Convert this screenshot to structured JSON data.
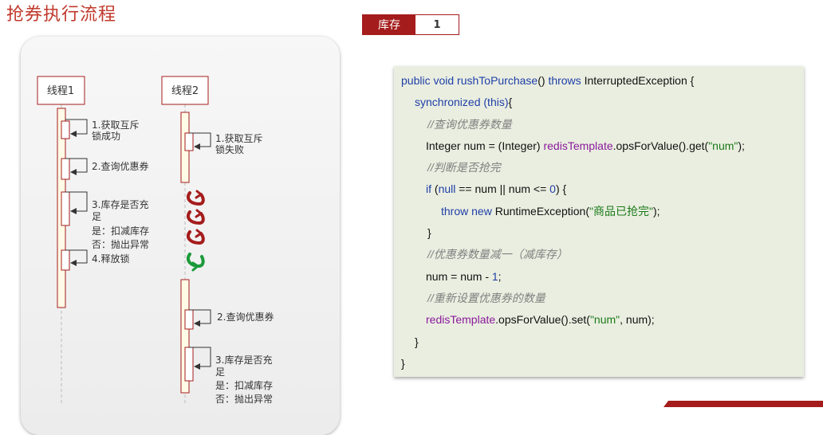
{
  "title": "抢券执行流程",
  "stock": {
    "label": "库存",
    "value": "1"
  },
  "diagram": {
    "thread1": "线程1",
    "thread2": "线程2",
    "t1_steps": {
      "s1a": "1.获取互斥",
      "s1b": "锁成功",
      "s2": "2.查询优惠券",
      "s3a": "3.库存是否充",
      "s3b": "足",
      "s3c": "是：扣减库存",
      "s3d": "否：抛出异常",
      "s4": "4.释放锁"
    },
    "t2_steps": {
      "s1a": "1.获取互斥",
      "s1b": "锁失败",
      "s2": "2.查询优惠券",
      "s3a": "3.库存是否充",
      "s3b": "足",
      "s3c": "是：扣减库存",
      "s3d": "否：抛出异常"
    }
  },
  "code": {
    "l1": {
      "a": "public void ",
      "b": "rushToPurchase",
      "c": "() ",
      "d": "throws ",
      "e": "InterruptedException {"
    },
    "l2": {
      "a": "synchronized ",
      "b": "(this)",
      "c": "{"
    },
    "l3": "//查询优惠券数量",
    "l4": {
      "a": "Integer num = (Integer) ",
      "b": "redisTemplate",
      "c": ".opsForValue().get(",
      "d": "\"num\"",
      "e": ");"
    },
    "l5": "//判断是否抢完",
    "l6": {
      "a": "if ",
      "b": "(",
      "c": "null",
      "d": " == num || num <= ",
      "e": "0",
      "f": ") {"
    },
    "l7": {
      "a": "throw new ",
      "b": "RuntimeException(",
      "c": "\"商品已抢完\"",
      "d": ");"
    },
    "l8": "}",
    "l9": "//优惠券数量减一（减库存）",
    "l10": {
      "a": "num = num - ",
      "b": "1",
      "c": ";"
    },
    "l11": "//重新设置优惠券的数量",
    "l12": {
      "a": "redisTemplate",
      "b": ".opsForValue().set(",
      "c": "\"num\"",
      "d": ", num);"
    },
    "l13": "}",
    "l14": "}"
  }
}
